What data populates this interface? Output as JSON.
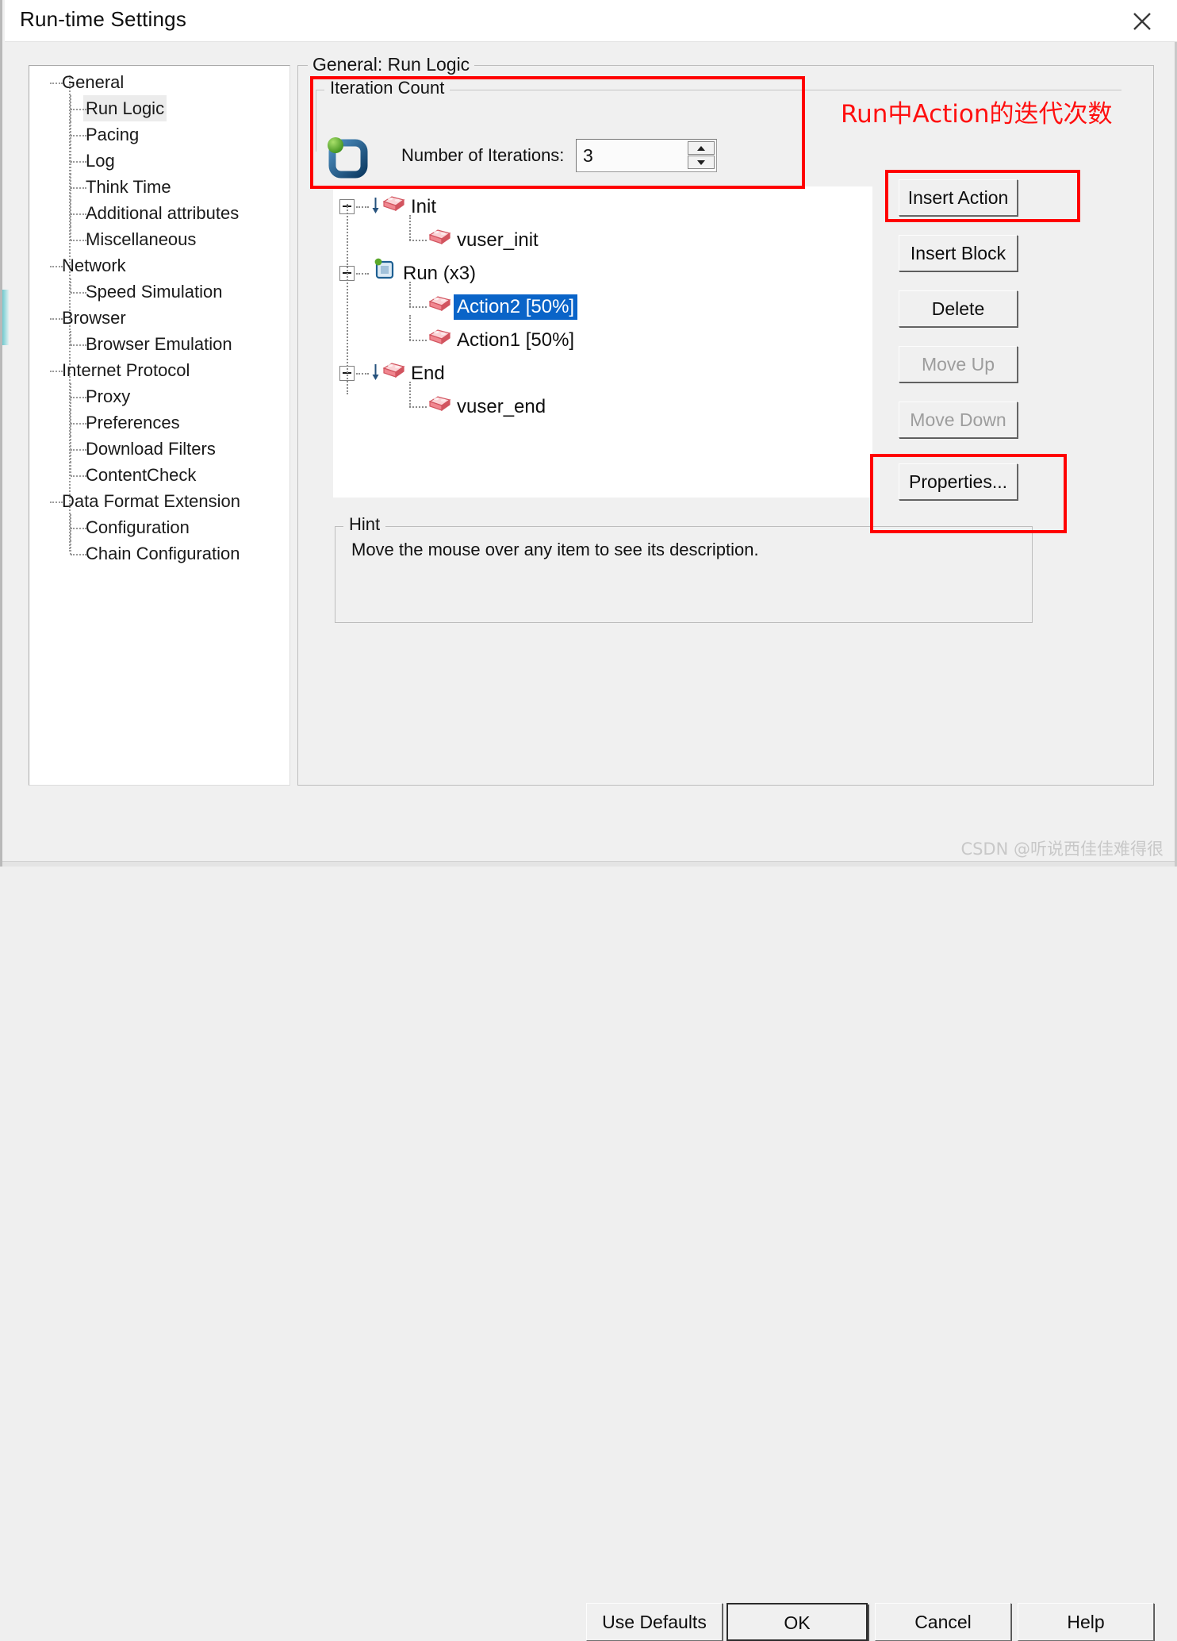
{
  "window": {
    "title": "Run-time Settings",
    "close_icon": "close-icon"
  },
  "sidebar": {
    "items": [
      {
        "label": "General",
        "level": 0,
        "selected": false
      },
      {
        "label": "Run Logic",
        "level": 1,
        "selected": true
      },
      {
        "label": "Pacing",
        "level": 1,
        "selected": false
      },
      {
        "label": "Log",
        "level": 1,
        "selected": false
      },
      {
        "label": "Think Time",
        "level": 1,
        "selected": false
      },
      {
        "label": "Additional attributes",
        "level": 1,
        "selected": false
      },
      {
        "label": "Miscellaneous",
        "level": 1,
        "selected": false
      },
      {
        "label": "Network",
        "level": 0,
        "selected": false
      },
      {
        "label": "Speed Simulation",
        "level": 1,
        "selected": false
      },
      {
        "label": "Browser",
        "level": 0,
        "selected": false
      },
      {
        "label": "Browser Emulation",
        "level": 1,
        "selected": false
      },
      {
        "label": "Internet Protocol",
        "level": 0,
        "selected": false
      },
      {
        "label": "Proxy",
        "level": 1,
        "selected": false
      },
      {
        "label": "Preferences",
        "level": 1,
        "selected": false
      },
      {
        "label": "Download Filters",
        "level": 1,
        "selected": false
      },
      {
        "label": "ContentCheck",
        "level": 1,
        "selected": false
      },
      {
        "label": "Data Format Extension",
        "level": 0,
        "selected": false
      },
      {
        "label": "Configuration",
        "level": 1,
        "selected": false
      },
      {
        "label": "Chain Configuration",
        "level": 1,
        "selected": false
      }
    ]
  },
  "main": {
    "group_title": "General: Run Logic",
    "iteration": {
      "group_title": "Iteration Count",
      "label": "Number of Iterations:",
      "value": "3",
      "icon": "loop-iteration-icon",
      "spin_up_icon": "spin-up-arrow-icon",
      "spin_down_icon": "spin-down-arrow-icon"
    },
    "run_logic_tree": [
      {
        "label": "Init",
        "level": 0,
        "selected": false,
        "expander": true,
        "icon": "init-block-icon"
      },
      {
        "label": "vuser_init",
        "level": 1,
        "selected": false,
        "expander": false,
        "icon": "action-block-icon"
      },
      {
        "label": "Run  (x3)",
        "level": 0,
        "selected": false,
        "expander": true,
        "icon": "run-block-icon"
      },
      {
        "label": "Action2 [50%]",
        "level": 1,
        "selected": true,
        "expander": false,
        "icon": "action-block-icon"
      },
      {
        "label": "Action1 [50%]",
        "level": 1,
        "selected": false,
        "expander": false,
        "icon": "action-block-icon"
      },
      {
        "label": "End",
        "level": 0,
        "selected": false,
        "expander": true,
        "icon": "end-block-icon"
      },
      {
        "label": "vuser_end",
        "level": 1,
        "selected": false,
        "expander": false,
        "icon": "action-block-icon"
      }
    ],
    "side_buttons": [
      {
        "label": "Insert Action",
        "disabled": false
      },
      {
        "label": "Insert Block",
        "disabled": false
      },
      {
        "label": "Delete",
        "disabled": false
      },
      {
        "label": "Move Up",
        "disabled": true
      },
      {
        "label": "Move Down",
        "disabled": true
      },
      {
        "label": "Properties...",
        "disabled": false
      }
    ],
    "hint": {
      "group_title": "Hint",
      "text": "Move the mouse over any item to see its description."
    }
  },
  "annotations": {
    "note_text": "Run中Action的迭代次数",
    "note_color": "#ff0f0f"
  },
  "footer": {
    "buttons": [
      {
        "label": "Use Defaults",
        "default": false
      },
      {
        "label": "OK",
        "default": true
      },
      {
        "label": "Cancel",
        "default": false
      },
      {
        "label": "Help",
        "default": false
      }
    ],
    "watermark": "CSDN @听说西佳佳难得很"
  }
}
